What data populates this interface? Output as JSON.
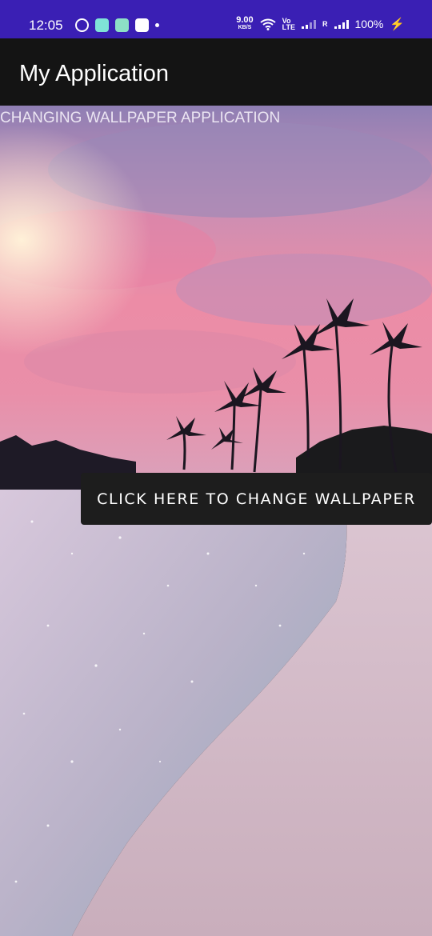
{
  "status_bar": {
    "time": "12:05",
    "net_speed_value": "9.00",
    "net_speed_unit": "KB/S",
    "volte_label_top": "Vo",
    "volte_label_bottom": "LTE",
    "roaming_label": "R",
    "battery": "100%",
    "icons": [
      "whatsapp-icon",
      "app-icon",
      "app-icon",
      "gallery-icon",
      "dot-icon",
      "wifi-icon",
      "signal-icon",
      "signal-icon",
      "charging-icon"
    ]
  },
  "app_bar": {
    "title": "My Application"
  },
  "main": {
    "banner_text": "CHANGING WALLPAPER APPLICATION",
    "change_button_label": "CLICK HERE TO CHANGE WALLPAPER"
  },
  "colors": {
    "status_bar": "#3a1fb4",
    "app_bar": "#141414",
    "button_bg": "#1d1d1d"
  }
}
